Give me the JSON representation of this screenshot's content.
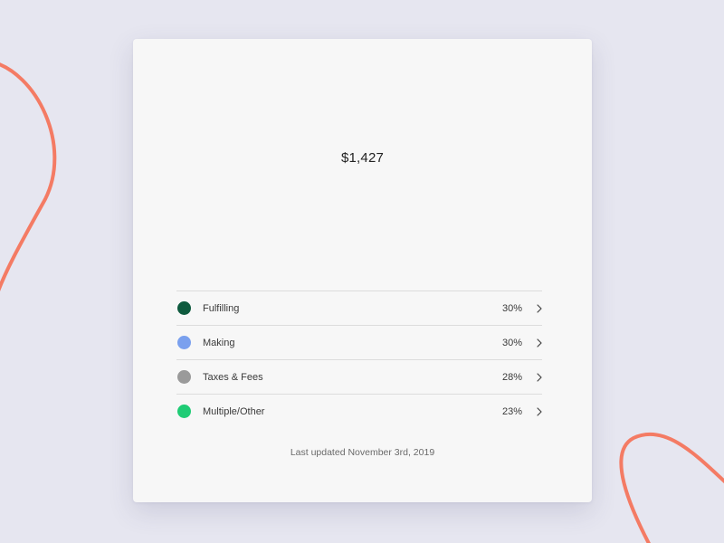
{
  "summary": {
    "total": "$1,427"
  },
  "breakdown": {
    "items": [
      {
        "label": "Fulfilling",
        "percent": "30%",
        "color": "#0e5a3e"
      },
      {
        "label": "Making",
        "percent": "30%",
        "color": "#7aa0ee"
      },
      {
        "label": "Taxes & Fees",
        "percent": "28%",
        "color": "#9a9a9a"
      },
      {
        "label": "Multiple/Other",
        "percent": "23%",
        "color": "#1fcc75"
      }
    ]
  },
  "footer": {
    "last_updated": "Last updated November 3rd, 2019"
  },
  "theme": {
    "background": "#e6e6f0",
    "card": "#f7f7f7",
    "accent_curve": "#f47b64"
  }
}
